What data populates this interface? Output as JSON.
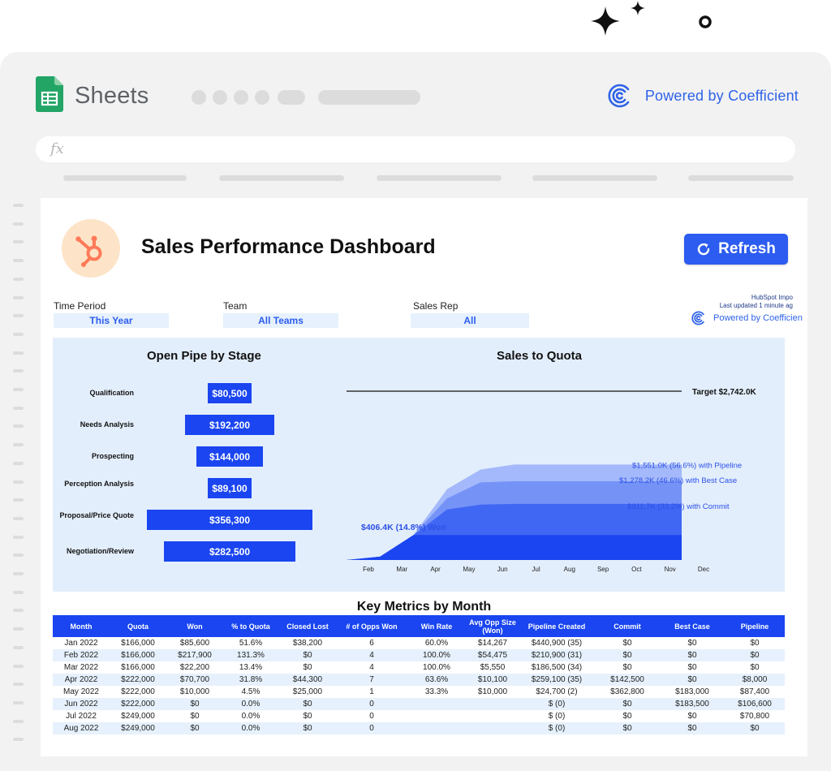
{
  "app": {
    "name": "Sheets",
    "formula_bar_label": "fx",
    "powered_by": "Powered by Coefficient"
  },
  "colors": {
    "accent": "#2c5cf0",
    "bar": "#1a45f0",
    "panel": "#e3eefc",
    "sheets_green": "#23a566",
    "hubspot_orange": "#ff7a59"
  },
  "icons": [
    "sparkle-icon",
    "circle-icon",
    "sheets-logo-icon",
    "coefficient-logo-icon",
    "hubspot-logo-icon",
    "refresh-icon"
  ],
  "dashboard": {
    "title": "Sales Performance Dashboard",
    "refresh_label": "Refresh",
    "import_source": "HubSpot Impo",
    "last_updated": "Last updated 1 minute ag",
    "powered_by": "Powered by Coefficien"
  },
  "filters": [
    {
      "label": "Time Period",
      "value": "This Year"
    },
    {
      "label": "Team",
      "value": "All Teams"
    },
    {
      "label": "Sales Rep",
      "value": "All"
    }
  ],
  "chart_data": [
    {
      "type": "bar",
      "orientation": "horizontal-funnel",
      "title": "Open Pipe by Stage",
      "categories": [
        "Qualification",
        "Needs Analysis",
        "Prospecting",
        "Perception Analysis",
        "Proposal/Price Quote",
        "Negotiation/Review"
      ],
      "values": [
        80500,
        192200,
        144000,
        89100,
        356300,
        282500
      ],
      "data_labels": [
        "$80,500",
        "$192,200",
        "$144,000",
        "$89,100",
        "$356,300",
        "$282,500"
      ]
    },
    {
      "type": "area",
      "title": "Sales to Quota",
      "categories": [
        "Feb",
        "Mar",
        "Apr",
        "May",
        "Jun",
        "Jul",
        "Aug",
        "Sep",
        "Oct",
        "Nov",
        "Dec"
      ],
      "ylim": [
        0,
        2742
      ],
      "target": {
        "value": 2742,
        "label": "Target $2,742.0K"
      },
      "series": [
        {
          "name": "with Pipeline",
          "label": "$1,551.0K (56.6%) with Pipeline",
          "color": "#a3b9fb",
          "values": [
            0,
            55,
            406,
            1150,
            1470,
            1551,
            1551,
            1551,
            1551,
            1551,
            1551
          ]
        },
        {
          "name": "with Best Case",
          "label": "$1,278.2K (46.6%) with Best Case",
          "color": "#7593f7",
          "values": [
            0,
            55,
            406,
            1000,
            1260,
            1278,
            1278,
            1278,
            1278,
            1278,
            1278
          ]
        },
        {
          "name": "with Commit",
          "label": "$911.7K (33.2%) with Commit",
          "color": "#4067f3",
          "values": [
            0,
            55,
            406,
            820,
            900,
            912,
            912,
            912,
            912,
            912,
            912
          ]
        },
        {
          "name": "Won",
          "label": "$406.4K (14.8%) Won",
          "color": "#1a45f0",
          "values": [
            0,
            55,
            406,
            406,
            406,
            406,
            406,
            406,
            406,
            406,
            406
          ]
        }
      ]
    }
  ],
  "metrics": {
    "title": "Key Metrics by Month",
    "headers": [
      "Month",
      "Quota",
      "Won",
      "% to Quota",
      "Closed Lost",
      "# of Opps Won",
      "Win Rate",
      "Avg Opp Size (Won)",
      "Pipeline Created",
      "Commit",
      "Best Case",
      "Pipeline"
    ],
    "rows": [
      [
        "Jan 2022",
        "$166,000",
        "$85,600",
        "51.6%",
        "$38,200",
        "6",
        "60.0%",
        "$14,267",
        "$440,900 (35)",
        "$0",
        "$0",
        "$0"
      ],
      [
        "Feb 2022",
        "$166,000",
        "$217,900",
        "131.3%",
        "$0",
        "4",
        "100.0%",
        "$54,475",
        "$210,900 (31)",
        "$0",
        "$0",
        "$0"
      ],
      [
        "Mar 2022",
        "$166,000",
        "$22,200",
        "13.4%",
        "$0",
        "4",
        "100.0%",
        "$5,550",
        "$186,500 (34)",
        "$0",
        "$0",
        "$0"
      ],
      [
        "Apr 2022",
        "$222,000",
        "$70,700",
        "31.8%",
        "$44,300",
        "7",
        "63.6%",
        "$10,100",
        "$259,100 (35)",
        "$142,500",
        "$0",
        "$8,000"
      ],
      [
        "May 2022",
        "$222,000",
        "$10,000",
        "4.5%",
        "$25,000",
        "1",
        "33.3%",
        "$10,000",
        "$24,700 (2)",
        "$362,800",
        "$183,000",
        "$87,400"
      ],
      [
        "Jun 2022",
        "$222,000",
        "$0",
        "0.0%",
        "$0",
        "0",
        "",
        "",
        "$ (0)",
        "$0",
        "$183,500",
        "$106,600"
      ],
      [
        "Jul 2022",
        "$249,000",
        "$0",
        "0.0%",
        "$0",
        "0",
        "",
        "",
        "$ (0)",
        "$0",
        "$0",
        "$70,800"
      ],
      [
        "Aug 2022",
        "$249,000",
        "$0",
        "0.0%",
        "$0",
        "0",
        "",
        "",
        "$ (0)",
        "$0",
        "$0",
        "$0"
      ]
    ]
  }
}
